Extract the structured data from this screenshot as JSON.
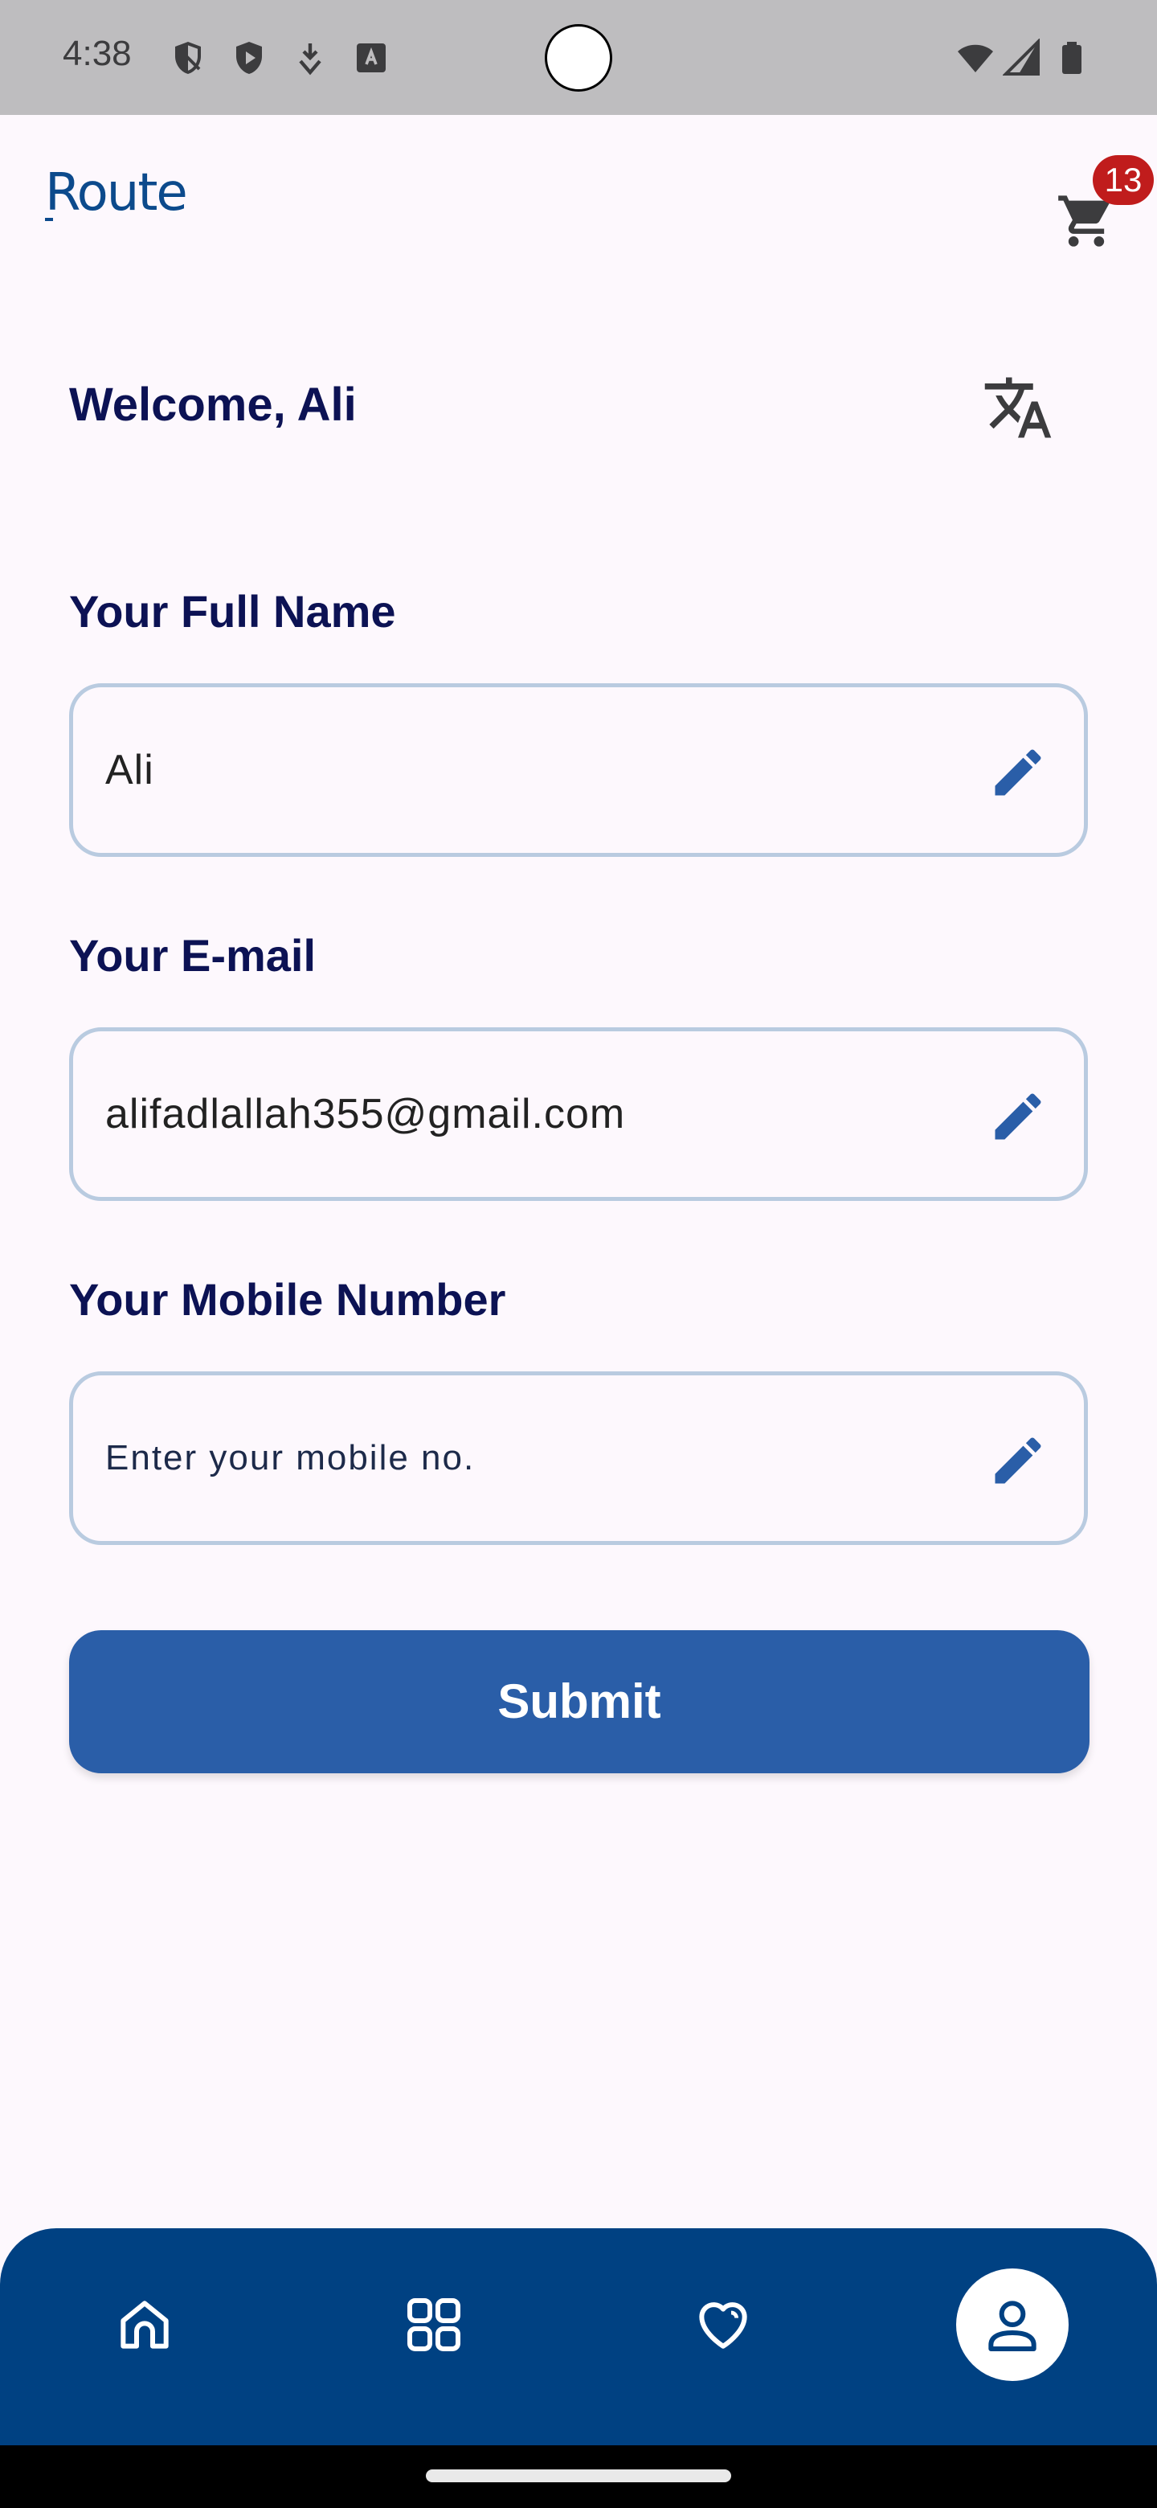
{
  "status_bar": {
    "time": "4:38",
    "icons": [
      "shield-icon",
      "play-shield-icon",
      "download-icon",
      "keyboard-icon",
      "wifi-icon",
      "signal-icon",
      "battery-icon"
    ]
  },
  "header": {
    "logo_text": "Route",
    "cart_icon": "cart-icon",
    "cart_count": "13"
  },
  "profile": {
    "welcome": "Welcome, Ali",
    "translate_icon": "translate-icon",
    "fields": [
      {
        "label": "Your Full Name",
        "value": "Ali",
        "placeholder": ""
      },
      {
        "label": "Your E-mail",
        "value": "alifadlallah355@gmail.com",
        "placeholder": ""
      },
      {
        "label": "Your Mobile Number",
        "value": "",
        "placeholder": "Enter your mobile no."
      }
    ],
    "submit_label": "Submit"
  },
  "bottom_nav": {
    "items": [
      {
        "name": "home",
        "icon": "home-icon",
        "active": false
      },
      {
        "name": "categories",
        "icon": "grid-icon",
        "active": false
      },
      {
        "name": "wishlist",
        "icon": "heart-icon",
        "active": false
      },
      {
        "name": "profile",
        "icon": "person-icon",
        "active": true
      }
    ]
  },
  "colors": {
    "primary": "#2a5ea8",
    "nav_background": "#004182",
    "heading": "#0c1254",
    "field_border": "#b9cbe0",
    "badge": "#c01c1c",
    "background": "#fdf8fd"
  }
}
